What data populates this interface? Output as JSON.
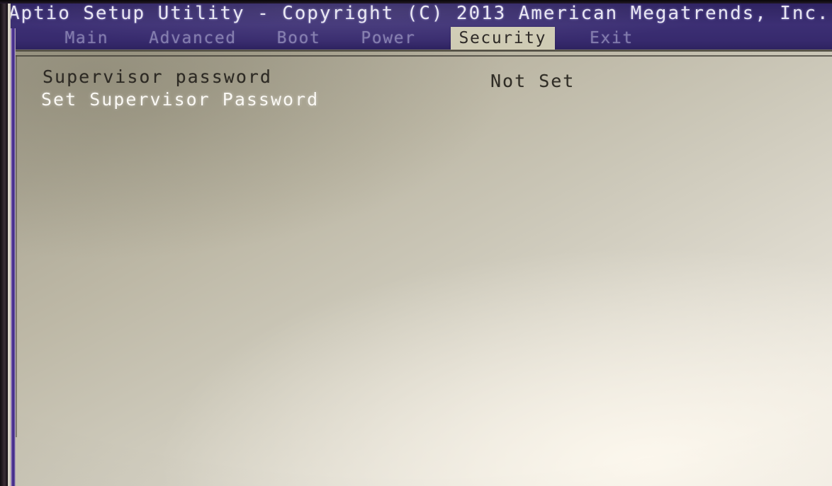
{
  "window": {
    "title": "Aptio Setup Utility - Copyright (C) 2013 American Megatrends, Inc."
  },
  "tabs": [
    {
      "label": "Main",
      "active": false
    },
    {
      "label": "Advanced",
      "active": false
    },
    {
      "label": "Boot",
      "active": false
    },
    {
      "label": "Power",
      "active": false
    },
    {
      "label": "Security",
      "active": true
    },
    {
      "label": "Exit",
      "active": false
    }
  ],
  "active_tab": "Security",
  "settings": [
    {
      "label": "Supervisor password",
      "value": "Not Set",
      "type": "status",
      "selected": false
    },
    {
      "label": "Set Supervisor Password",
      "value": "",
      "type": "action",
      "selected": true
    }
  ],
  "colors": {
    "header_blue": "#372a6d",
    "active_tab_bg": "#cfcbb4",
    "active_tab_fg": "#2b2724",
    "inactive_tab_fg": "#837cad",
    "panel_light": "#efebe2",
    "panel_dark": "#a7a291",
    "title_text": "#e8e6f2",
    "label_dark": "#2d2a24",
    "label_highlight": "#fbf9f4",
    "violet_rule": "#3a2480",
    "bezel": "#1a141c"
  }
}
